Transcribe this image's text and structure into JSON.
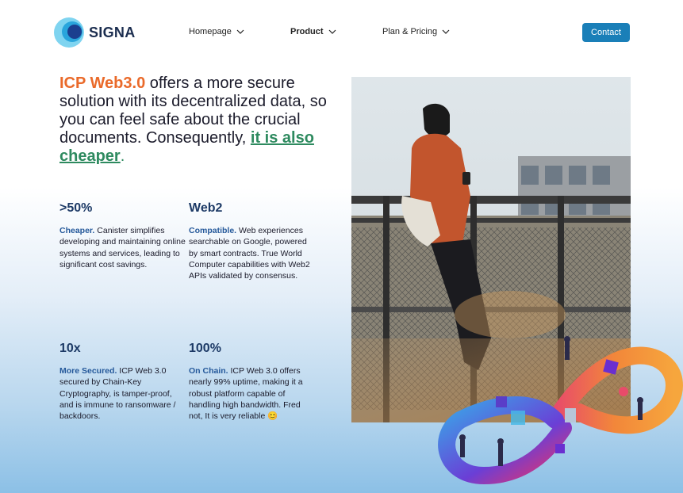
{
  "brand": {
    "name": "SIGNA"
  },
  "nav": {
    "items": [
      {
        "label": "Homepage"
      },
      {
        "label": "Product"
      },
      {
        "label": "Plan & Pricing"
      }
    ],
    "contact_label": "Contact"
  },
  "hero": {
    "accent": "ICP Web3.0",
    "text": " offers a more secure solution with its decentralized data, so you can feel safe about the crucial documents. Consequently, ",
    "highlight": "it is also cheaper",
    "end": "."
  },
  "stats": [
    {
      "value": ">50%",
      "lead": "Cheaper.",
      "text": " Canister simplifies developing and maintaining online systems and services, leading to significant cost savings."
    },
    {
      "value": "Web2",
      "lead": "Compatible.",
      "text": " Web experiences searchable on Google, powered by smart contracts. True World Computer capabilities with Web2 APIs validated by consensus."
    },
    {
      "value": "10x",
      "lead": "More Secured.",
      "text": " ICP Web 3.0 secured by Chain-Key Cryptography, is tamper-proof, and is immune to ransomware / backdoors."
    },
    {
      "value": "100%",
      "lead": "On Chain.",
      "text": " ICP Web 3.0 offers nearly 99% uptime, making it a robust platform capable of handling high bandwidth. Fred not, It is very reliable 😊"
    }
  ],
  "colors": {
    "accent_orange": "#ea6a2a",
    "accent_green": "#2e8a5f",
    "button_blue": "#1a7fb8",
    "navy": "#1d3a66"
  }
}
